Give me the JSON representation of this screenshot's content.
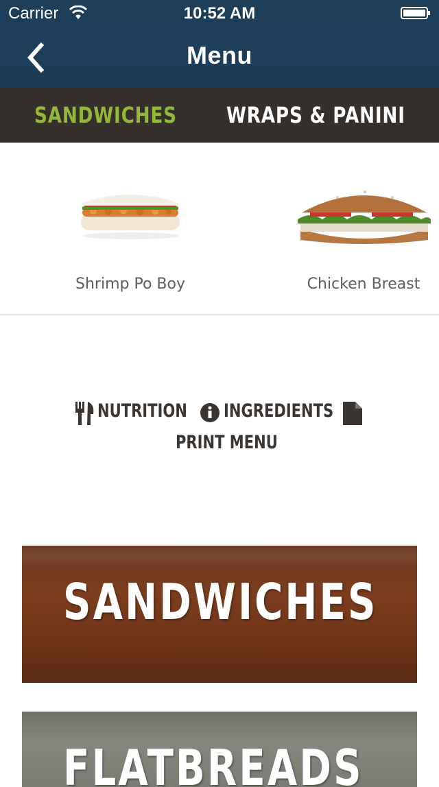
{
  "status_bar": {
    "carrier": "Carrier",
    "time": "10:52 AM"
  },
  "nav": {
    "title": "Menu",
    "back_icon": "chevron-left-icon"
  },
  "tabs": [
    {
      "label": "SANDWICHES",
      "active": true
    },
    {
      "label": "WRAPS & PANINI",
      "active": false
    }
  ],
  "carousel": {
    "items": [
      {
        "label": "Shrimp Po Boy"
      },
      {
        "label": "Chicken Breast"
      }
    ]
  },
  "actions": {
    "nutrition": "NUTRITION",
    "ingredients": "INGREDIENTS",
    "print_menu": "PRINT MENU"
  },
  "categories": [
    {
      "title": "SANDWICHES"
    },
    {
      "title": "FLATBREADS"
    }
  ],
  "colors": {
    "nav_blue": "#1d3e58",
    "tab_bar": "#35302c",
    "active_tab": "#93b83a",
    "action_text": "#3b3532"
  }
}
